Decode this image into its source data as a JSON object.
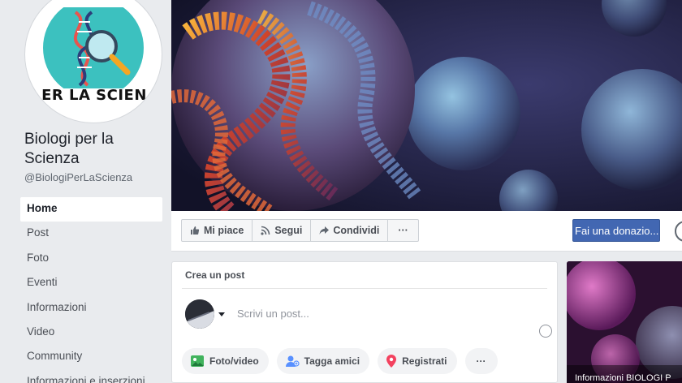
{
  "profile": {
    "logo_text": "ER LA SCIEN",
    "name": "Biologi per la Scienza",
    "handle": "@BiologiPerLaScienza"
  },
  "nav": {
    "items": [
      {
        "label": "Home",
        "active": true
      },
      {
        "label": "Post"
      },
      {
        "label": "Foto"
      },
      {
        "label": "Eventi"
      },
      {
        "label": "Informazioni"
      },
      {
        "label": "Video"
      },
      {
        "label": "Community"
      },
      {
        "label": "Informazioni e inserzioni"
      }
    ]
  },
  "actions": {
    "like": "Mi piace",
    "follow": "Segui",
    "share": "Condividi",
    "more": "···",
    "donate": "Fai una donazio..."
  },
  "create_post": {
    "title": "Crea un post",
    "placeholder": "Scrivi un post...",
    "buttons": {
      "photo_video": "Foto/video",
      "tag_friends": "Tagga amici",
      "checkin": "Registrati",
      "more": "···"
    }
  },
  "side": {
    "caption": "Informazioni BIOLOGI P"
  },
  "colors": {
    "primary_blue": "#4267b2",
    "background": "#e9ebee",
    "logo_teal": "#3cc1bf"
  }
}
